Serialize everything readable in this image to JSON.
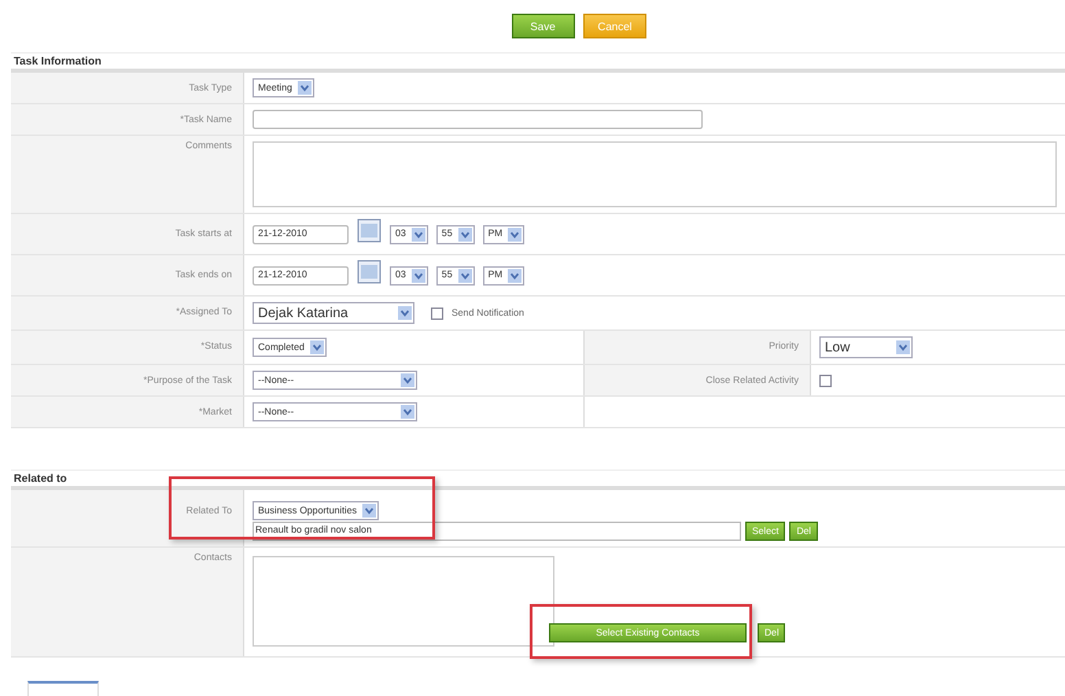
{
  "actions": [
    {
      "label": "Save",
      "kind": "save"
    },
    {
      "label": "Cancel",
      "kind": "cancel"
    }
  ],
  "task_information": {
    "title": "Task Information",
    "fields": [
      {
        "label": "Task Type",
        "kind": "select",
        "value": "Meeting"
      },
      {
        "label": "*Task Name",
        "kind": "text"
      },
      {
        "label": "Comments",
        "kind": "textarea"
      },
      {
        "label": "Task starts at",
        "kind": "datetime",
        "date": "21-12-2010",
        "hour": "03",
        "minute": "55",
        "period": "PM"
      },
      {
        "label": "Task ends on",
        "kind": "datetime",
        "date": "21-12-2010",
        "hour": "03",
        "minute": "55",
        "period": "PM"
      },
      {
        "label": "*Assigned To",
        "kind": "assignee",
        "value": "Dejak Katarina",
        "notification": {
          "label": "Send Notification",
          "checked": false
        }
      },
      {
        "label": "*Status",
        "kind": "select",
        "value": "Completed",
        "side": {
          "label": "Priority",
          "kind": "priority",
          "value": "Low"
        }
      },
      {
        "label": "*Purpose of the Task",
        "kind": "wide_select",
        "value": "--None--",
        "side": {
          "label": "Close Related Activity",
          "kind": "checkbox",
          "checked": false
        }
      },
      {
        "label": "*Market",
        "kind": "wide_select",
        "value": "--None--"
      }
    ]
  },
  "related": {
    "title": "Related to",
    "fields": [
      {
        "label": "Related To",
        "kind": "related",
        "value": "Business Opportunities",
        "record": "Renault bo gradil nov salon",
        "buttons": [
          "Select",
          "Del"
        ],
        "highlighted": true
      },
      {
        "label": "Contacts",
        "kind": "contacts",
        "buttons": [
          "Select Existing Contacts",
          "Del"
        ],
        "highlighted": true
      }
    ]
  }
}
